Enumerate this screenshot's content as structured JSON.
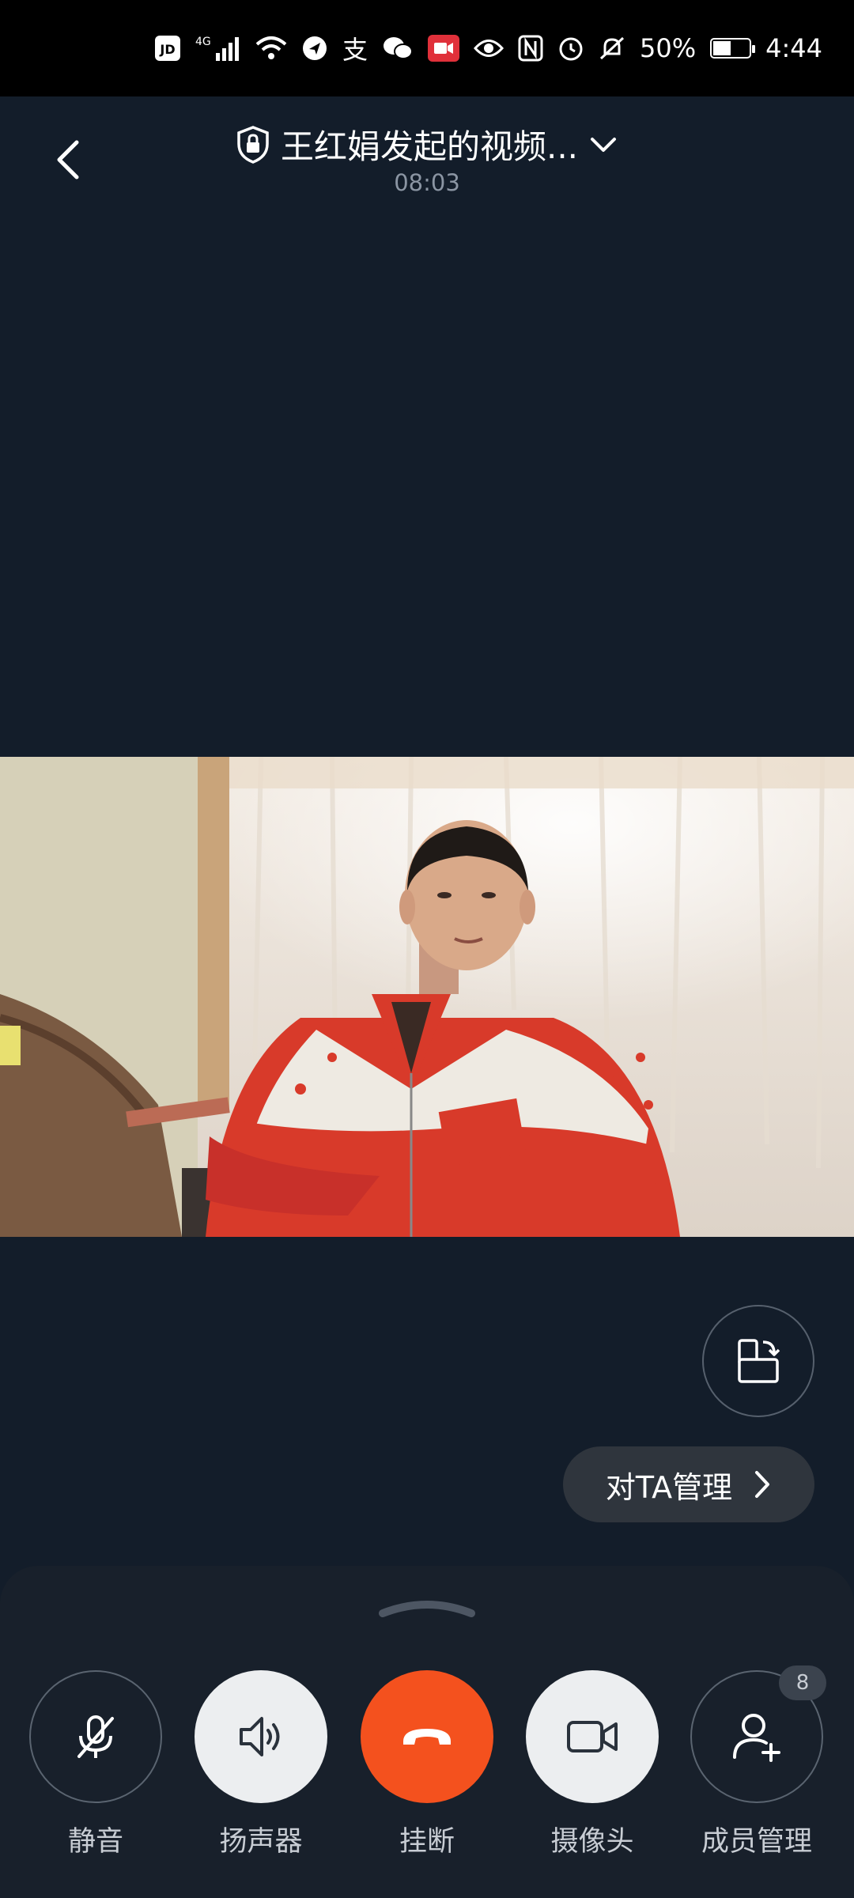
{
  "status_bar": {
    "carrier_badge": "JD",
    "network": "4G",
    "alipay_glyph": "支",
    "battery_text": "50%",
    "time": "4:44",
    "icons": [
      "jd-app-icon",
      "signal-icon",
      "wifi-icon",
      "location-icon",
      "alipay-icon",
      "wechat-icon",
      "screen-record-icon",
      "eye-icon",
      "nfc-icon",
      "alarm-icon",
      "mute-icon",
      "battery-icon"
    ],
    "battery_level": 0.5
  },
  "header": {
    "title": "王红娟发起的视频...",
    "duration": "08:03",
    "icons": {
      "back": "back-arrow-icon",
      "lock": "shield-lock-icon",
      "expand": "chevron-down-icon"
    }
  },
  "video": {
    "description_icon": "remote-video-feed"
  },
  "actions": {
    "rotate_icon": "screen-rotate-icon",
    "manage_label": "对TA管理",
    "manage_icon": "chevron-right-icon"
  },
  "controls": [
    {
      "label": "静音",
      "icon": "microphone-muted-icon"
    },
    {
      "label": "扬声器",
      "icon": "speaker-icon"
    },
    {
      "label": "挂断",
      "icon": "hang-up-icon"
    },
    {
      "label": "摄像头",
      "icon": "camera-icon"
    },
    {
      "label": "成员管理",
      "icon": "add-member-icon",
      "badge": "8"
    }
  ],
  "colors": {
    "background": "#131d2a",
    "hangup": "#f4511e",
    "light_button": "#eceef0",
    "panel": "#18202b"
  }
}
